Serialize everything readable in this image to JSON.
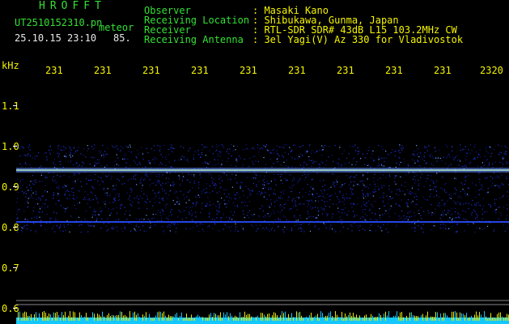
{
  "app": {
    "logo": "HROFFT"
  },
  "file": {
    "name": "UT2510152310.pn",
    "tag": "meteor",
    "datetime": "25.10.15 23:10",
    "count": "85."
  },
  "info": {
    "labels": [
      "Observer",
      "Receiving Location",
      "Receiver",
      "Receiving Antenna"
    ],
    "values": [
      ": Masaki Kano",
      ": Shibukawa, Gunma, Japan",
      ": RTL-SDR SDR# 43dB L15 103.2MHz CW",
      ": 3el Yagi(V) Az 330 for Vladivostok"
    ]
  },
  "axis": {
    "unit": "kHz",
    "freq_ticks": [
      "1.1",
      "1.0",
      "0.9",
      "0.8",
      "0.7",
      "0.6"
    ],
    "time_ticks": [
      "231",
      "231",
      "231",
      "231",
      "231",
      "231",
      "231",
      "231",
      "231",
      "2320"
    ]
  },
  "colors": {
    "label": "#33e033",
    "value": "#f4f400",
    "signal": "#2a3cff",
    "bar": "#14c8ff"
  }
}
